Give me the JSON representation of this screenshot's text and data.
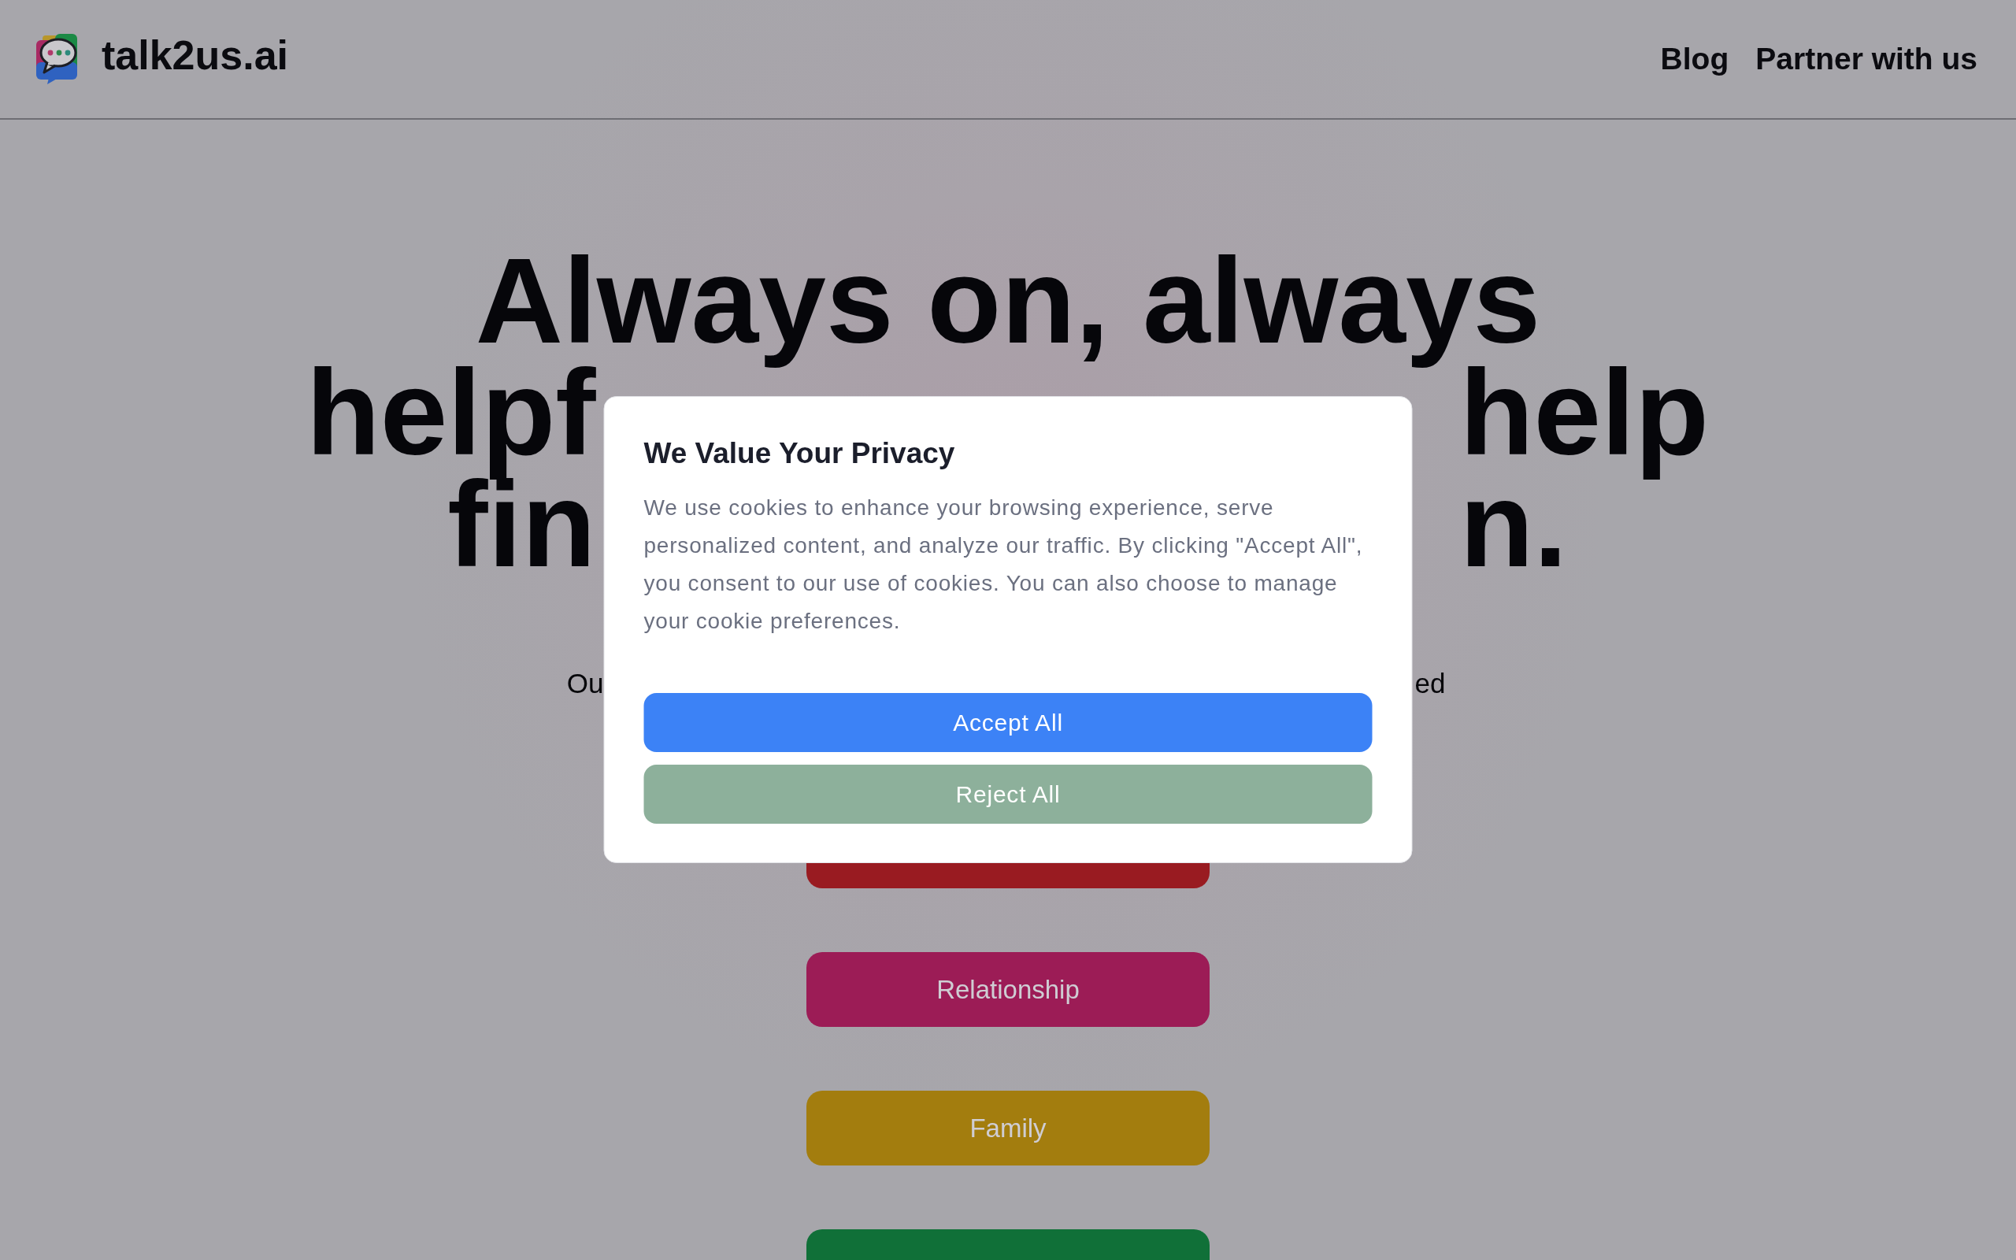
{
  "header": {
    "logo_text": "talk2us.ai",
    "nav": [
      "Blog",
      "Partner with us"
    ]
  },
  "hero": {
    "headline": [
      {
        "kind": "full",
        "text": "Always on, always"
      },
      {
        "kind": "split",
        "left": "helpf",
        "right": "help"
      },
      {
        "kind": "split",
        "left": "fin",
        "right": "n."
      }
    ],
    "subtitle": {
      "left": "Ou",
      "right": "ed"
    }
  },
  "topic_buttons": [
    {
      "color": "#991b21"
    },
    {
      "label": "Relationship",
      "color": "#9c1c56"
    },
    {
      "label": "Family",
      "color": "#a37d0e"
    },
    {
      "color": "#107038"
    }
  ],
  "cookie_dialog": {
    "title": "We Value Your Privacy",
    "text": "We use cookies to enhance your browsing experience, serve personalized content, and analyze our traffic. By clicking \"Accept All\", you consent to our use of cookies. You can also choose to manage your cookie preferences.",
    "buttons": [
      {
        "kind": "accept",
        "label": "Accept All"
      },
      {
        "kind": "reject",
        "label": "Reject All"
      }
    ]
  }
}
